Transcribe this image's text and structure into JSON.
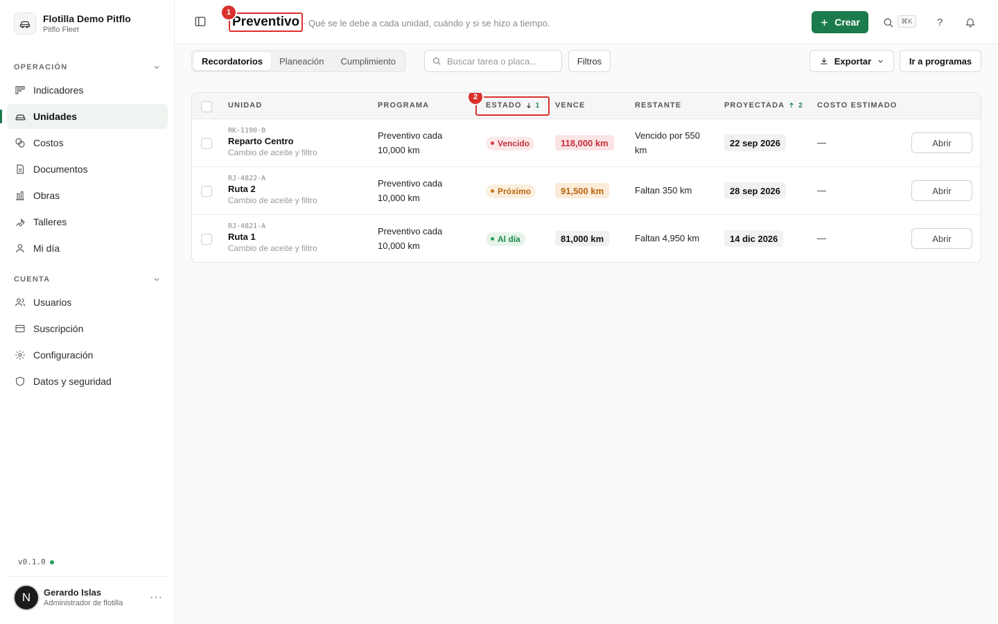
{
  "org": {
    "name": "Flotilla Demo Pitflo",
    "sub": "Pitflo Fleet"
  },
  "sidebar": {
    "section1": "OPERACIÓN",
    "items1": [
      {
        "label": "Indicadores",
        "icon": "chart-columns-icon"
      },
      {
        "label": "Unidades",
        "icon": "car-icon",
        "active": true
      },
      {
        "label": "Costos",
        "icon": "coins-icon"
      },
      {
        "label": "Documentos",
        "icon": "document-icon"
      },
      {
        "label": "Obras",
        "icon": "construction-icon"
      },
      {
        "label": "Talleres",
        "icon": "wrench-icon"
      },
      {
        "label": "Mi día",
        "icon": "person-icon"
      }
    ],
    "section2": "CUENTA",
    "items2": [
      {
        "label": "Usuarios",
        "icon": "users-icon"
      },
      {
        "label": "Suscripción",
        "icon": "credit-card-icon"
      },
      {
        "label": "Configuración",
        "icon": "gear-icon"
      },
      {
        "label": "Datos y seguridad",
        "icon": "shield-icon"
      }
    ],
    "version": "v0.1.0",
    "user": {
      "initial": "N",
      "name": "Gerardo Islas",
      "role": "Administrador de flotilla"
    }
  },
  "header": {
    "title": "Preventivo",
    "title_badge": "1",
    "subtitle": "· Qué se le debe a cada unidad, cuándo y si se hizo a tiempo.",
    "create_label": "Crear",
    "shortcut": "⌘K",
    "help": "?"
  },
  "toolbar": {
    "tabs": [
      "Recordatorios",
      "Planeación",
      "Cumplimiento"
    ],
    "search_placeholder": "Buscar tarea o placa...",
    "filters_label": "Filtros",
    "export_label": "Exportar",
    "programs_label": "Ir a programas"
  },
  "table": {
    "columns": {
      "unidad": "UNIDAD",
      "programa": "PROGRAMA",
      "estado": "ESTADO",
      "estado_sort": "1",
      "estado_badge": "2",
      "vence": "VENCE",
      "restante": "RESTANTE",
      "proyectada": "PROYECTADA",
      "proyectada_sort": "2",
      "costo": "COSTO ESTIMADO"
    },
    "rows": [
      {
        "plate": "RK-1190-B",
        "name": "Reparto Centro",
        "task": "Cambio de aceite y filtro",
        "program_l1": "Preventivo cada",
        "program_l2": "10,000 km",
        "status": "Vencido",
        "due": "118,000 km",
        "rest_l1": "Vencido por 550",
        "rest_l2": "km",
        "projected": "22 sep 2026",
        "cost": "—",
        "action": "Abrir"
      },
      {
        "plate": "RJ-4822-A",
        "name": "Ruta 2",
        "task": "Cambio de aceite y filtro",
        "program_l1": "Preventivo cada",
        "program_l2": "10,000 km",
        "status": "Próximo",
        "due": "91,500 km",
        "rest_l1": "Faltan 350 km",
        "rest_l2": "",
        "projected": "28 sep 2026",
        "cost": "—",
        "action": "Abrir"
      },
      {
        "plate": "RJ-4821-A",
        "name": "Ruta 1",
        "task": "Cambio de aceite y filtro",
        "program_l1": "Preventivo cada",
        "program_l2": "10,000 km",
        "status": "Al día",
        "due": "81,000 km",
        "rest_l1": "Faltan 4,950 km",
        "rest_l2": "",
        "projected": "14 dic 2026",
        "cost": "—",
        "action": "Abrir"
      }
    ]
  },
  "colors": {
    "accent": "#1c7b4c",
    "annotation": "#d9302c",
    "overdue": "#c8303a",
    "upcoming": "#b8650f",
    "ok": "#1f8a4c"
  }
}
